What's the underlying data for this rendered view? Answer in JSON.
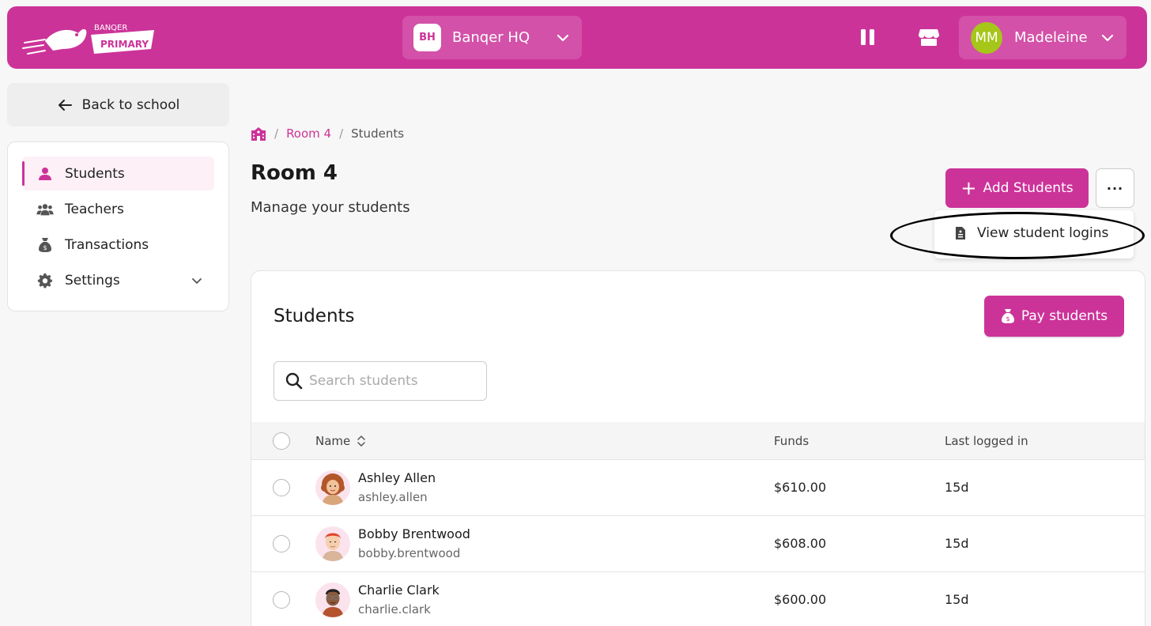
{
  "header": {
    "logo_top": "BANQER",
    "logo_bottom": "PRIMARY",
    "school_badge": "BH",
    "school_name": "Banqer HQ",
    "user_initials": "MM",
    "user_name": "Madeleine",
    "accent": "#cc3399"
  },
  "sidebar": {
    "back_label": "Back to school",
    "items": [
      {
        "label": "Students",
        "icon": "user-icon"
      },
      {
        "label": "Teachers",
        "icon": "users-icon"
      },
      {
        "label": "Transactions",
        "icon": "money-bag-icon"
      },
      {
        "label": "Settings",
        "icon": "gear-icon"
      }
    ]
  },
  "breadcrumb": {
    "sep": "/",
    "room": "Room 4",
    "current": "Students"
  },
  "page": {
    "title": "Room 4",
    "subtitle": "Manage your students",
    "add_label": "Add Students",
    "more_label": "···",
    "menu_item": "View student logins"
  },
  "card": {
    "title": "Students",
    "pay_label": "Pay students",
    "search_placeholder": "Search students",
    "columns": {
      "name": "Name",
      "funds": "Funds",
      "last_login": "Last logged in"
    },
    "rows": [
      {
        "name": "Ashley Allen",
        "username": "ashley.allen",
        "funds": "$610.00",
        "last_login": "15d"
      },
      {
        "name": "Bobby Brentwood",
        "username": "bobby.brentwood",
        "funds": "$608.00",
        "last_login": "15d"
      },
      {
        "name": "Charlie Clark",
        "username": "charlie.clark",
        "funds": "$600.00",
        "last_login": "15d"
      }
    ]
  }
}
